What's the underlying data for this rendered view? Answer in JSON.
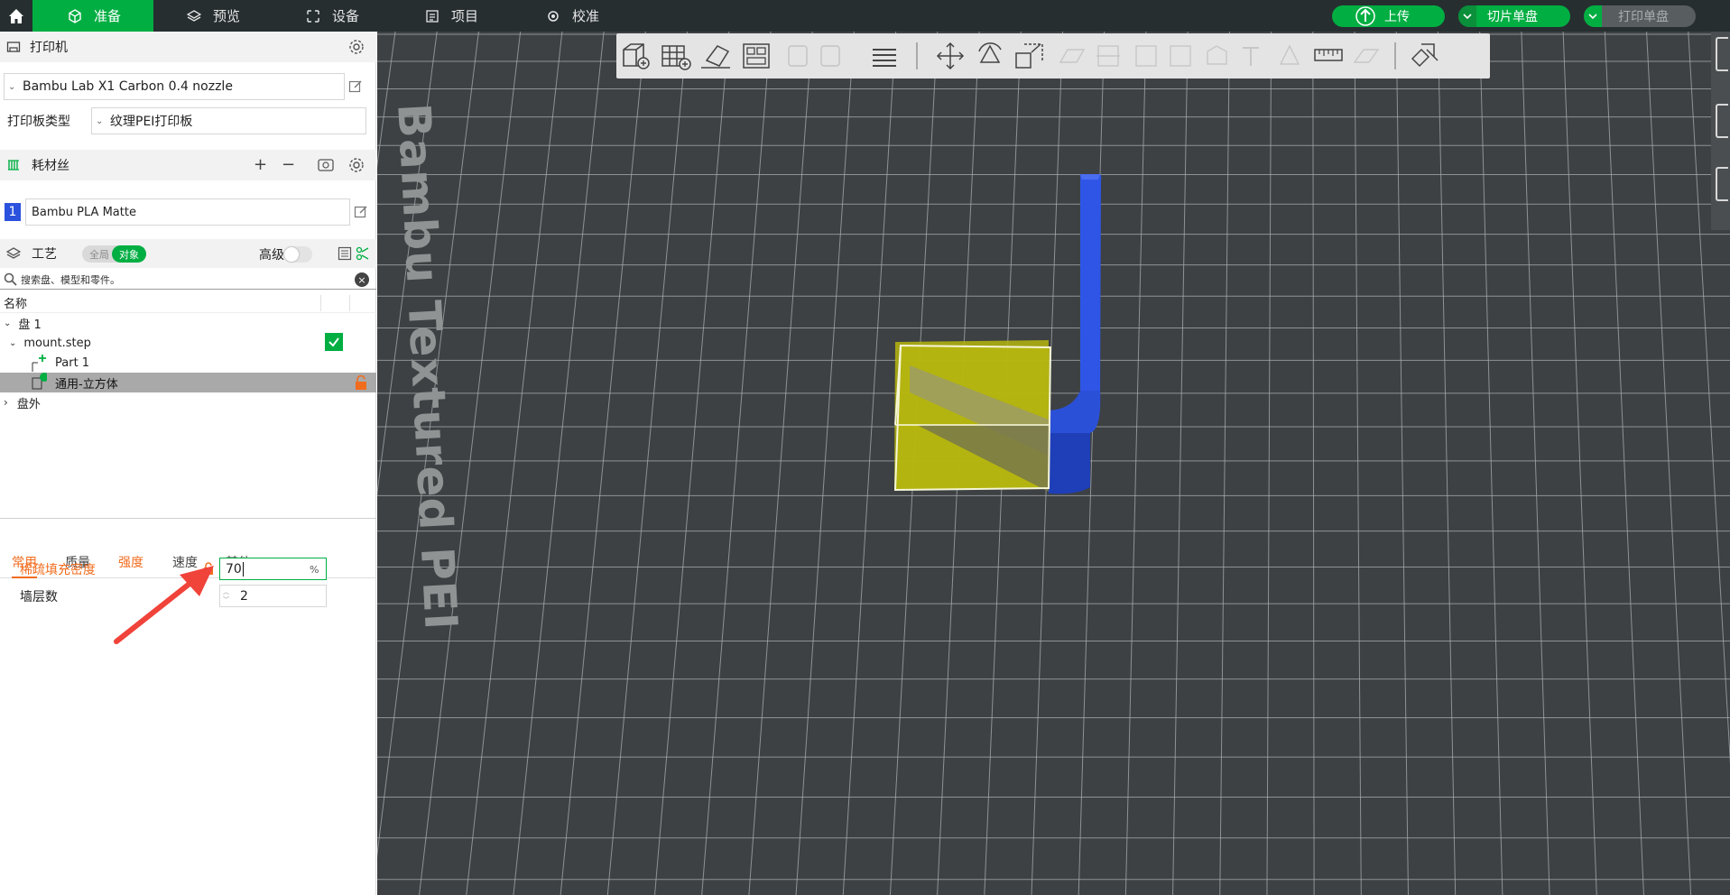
{
  "topbar": {
    "tabs": [
      {
        "label": "准备",
        "icon": "cube-icon",
        "active": true
      },
      {
        "label": "预览",
        "icon": "layers-icon",
        "active": false
      },
      {
        "label": "设备",
        "icon": "device-icon",
        "active": false
      },
      {
        "label": "项目",
        "icon": "project-icon",
        "active": false
      },
      {
        "label": "校准",
        "icon": "calibrate-icon",
        "active": false
      }
    ],
    "upload_label": "上传",
    "slice_label": "切片单盘",
    "print_label": "打印单盘",
    "accent": "#00ae42",
    "bar_color": "#262e30"
  },
  "printer": {
    "title": "打印机",
    "name": "Bambu Lab X1 Carbon 0.4 nozzle",
    "plate_type_label": "打印板类型",
    "plate_type_value": "纹理PEI打印板"
  },
  "filament": {
    "title": "耗材丝",
    "slot_number": "1",
    "slot_color": "#2b52dd",
    "material": "Bambu PLA Matte"
  },
  "process": {
    "title": "工艺",
    "toggle_global": "全局",
    "toggle_object": "对象",
    "advanced_label": "高级",
    "search_placeholder": "搜索盘、模型和零件。"
  },
  "object_tree": {
    "header_name": "名称",
    "plate1": "盘 1",
    "object": "mount.step",
    "part1": "Part 1",
    "modifier": "通用-立方体",
    "outside": "盘外"
  },
  "params": {
    "tabs": [
      "常用",
      "质量",
      "强度",
      "速度",
      "其他"
    ],
    "infill_label": "稀疏填充密度",
    "infill_value": "70",
    "infill_unit": "%",
    "walls_label": "墙层数",
    "walls_value": "2"
  },
  "viewport": {
    "bed_text": "Bambu Textured PEI",
    "background": "#3d4143",
    "object_color": "#2b52dd",
    "modifier_color": "#c8c810"
  }
}
